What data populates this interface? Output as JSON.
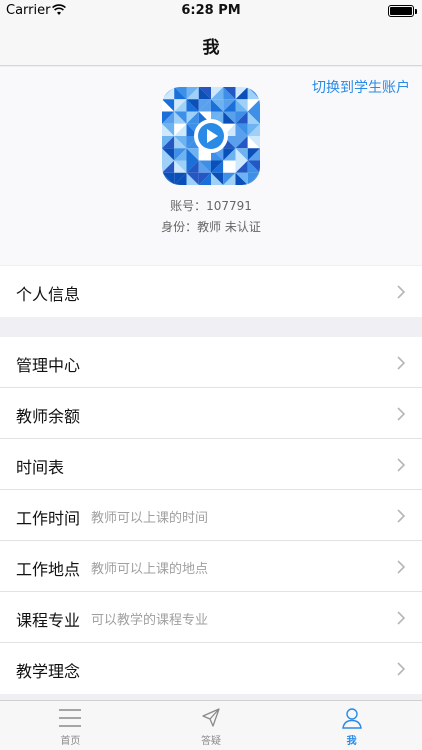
{
  "status_bar": {
    "carrier": "Carrier",
    "time": "6:28 PM"
  },
  "nav": {
    "title": "我"
  },
  "profile": {
    "switch_link": "切换到学生账户",
    "account": "账号：107791",
    "role": "身份：教师  未认证"
  },
  "personal_group": [
    {
      "label": "个人信息",
      "hint": ""
    }
  ],
  "settings_group": [
    {
      "label": "管理中心",
      "hint": ""
    },
    {
      "label": "教师余额",
      "hint": ""
    },
    {
      "label": "时间表",
      "hint": ""
    },
    {
      "label": "工作时间",
      "hint": "教师可以上课的时间"
    },
    {
      "label": "工作地点",
      "hint": "教师可以上课的地点"
    },
    {
      "label": "课程专业",
      "hint": "可以教学的课程专业"
    },
    {
      "label": "教学理念",
      "hint": ""
    }
  ],
  "tabs": [
    {
      "label": "首页",
      "icon": "menu-icon",
      "active": false
    },
    {
      "label": "答疑",
      "icon": "paper-plane-icon",
      "active": false
    },
    {
      "label": "我",
      "icon": "person-icon",
      "active": true
    }
  ],
  "colors": {
    "accent": "#2a8be6",
    "background": "#efeff4"
  }
}
